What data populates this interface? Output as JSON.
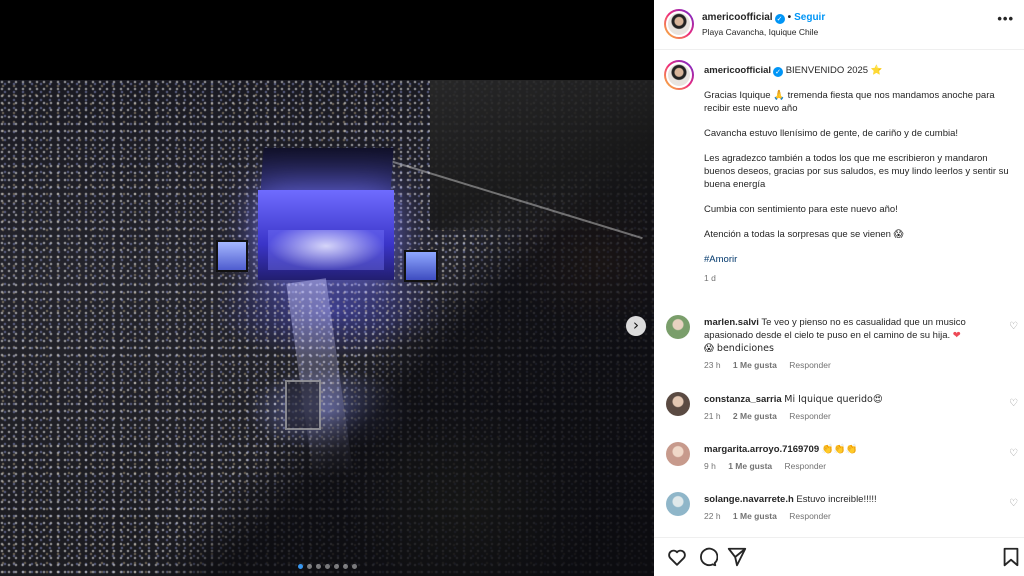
{
  "post": {
    "author": "americoofficial",
    "follow_label": "Seguir",
    "separator": "•",
    "location": "Playa Cavancha, Iquique Chile",
    "more_label": "•••",
    "verified_mark": "✓"
  },
  "caption": {
    "username": "americoofficial",
    "title": "BIENVENIDO 2025 ⭐",
    "paragraphs": [
      "Gracias Iquique 🙏 tremenda fiesta que nos mandamos anoche para recibir este nuevo año",
      "Cavancha estuvo llenísimo de gente, de cariño y de cumbia!",
      "Les agradezco también a todos los que me escribieron y mandaron buenos deseos, gracias por sus saludos, es muy lindo leerlos y sentir su buena energía",
      "Cumbia con sentimiento para este nuevo año!",
      "Atención a todas la sorpresas que se vienen 😱"
    ],
    "hashtag": "#Amorir",
    "time": "1 d"
  },
  "comments": [
    {
      "username": "marlen.salvi",
      "text": "Te veo y pienso no es casualidad que un musico apasionado desde el cielo te puso en el camino de su hija.",
      "heart_emoji": "❤",
      "text2": "😱 bendiciones",
      "time": "23 h",
      "likes": "1 Me gusta",
      "reply": "Responder",
      "avatar_color": "#7a9e6b"
    },
    {
      "username": "constanza_sarria",
      "text": "Mi Iquique querido😍",
      "time": "21 h",
      "likes": "2 Me gusta",
      "reply": "Responder",
      "avatar_color": "#5a4a42"
    },
    {
      "username": "margarita.arroyo.7169709",
      "text": "👏👏👏",
      "time": "9 h",
      "likes": "1 Me gusta",
      "reply": "Responder",
      "avatar_color": "#c79a8c"
    },
    {
      "username": "solange.navarrete.h",
      "text": "Estuvo increible!!!!!",
      "time": "22 h",
      "likes": "1 Me gusta",
      "reply": "Responder",
      "avatar_color": "#8fb6c9"
    }
  ],
  "carousel": {
    "next_glyph": "›",
    "dot_count": 7,
    "active_dot": 0
  },
  "comment_heart_glyph": "♡",
  "actions": [
    "heart-icon",
    "comment-icon",
    "share-icon",
    "bookmark-icon"
  ],
  "colors": {
    "link_blue": "#0095f6",
    "hashtag": "#00376b",
    "muted": "#737373"
  }
}
